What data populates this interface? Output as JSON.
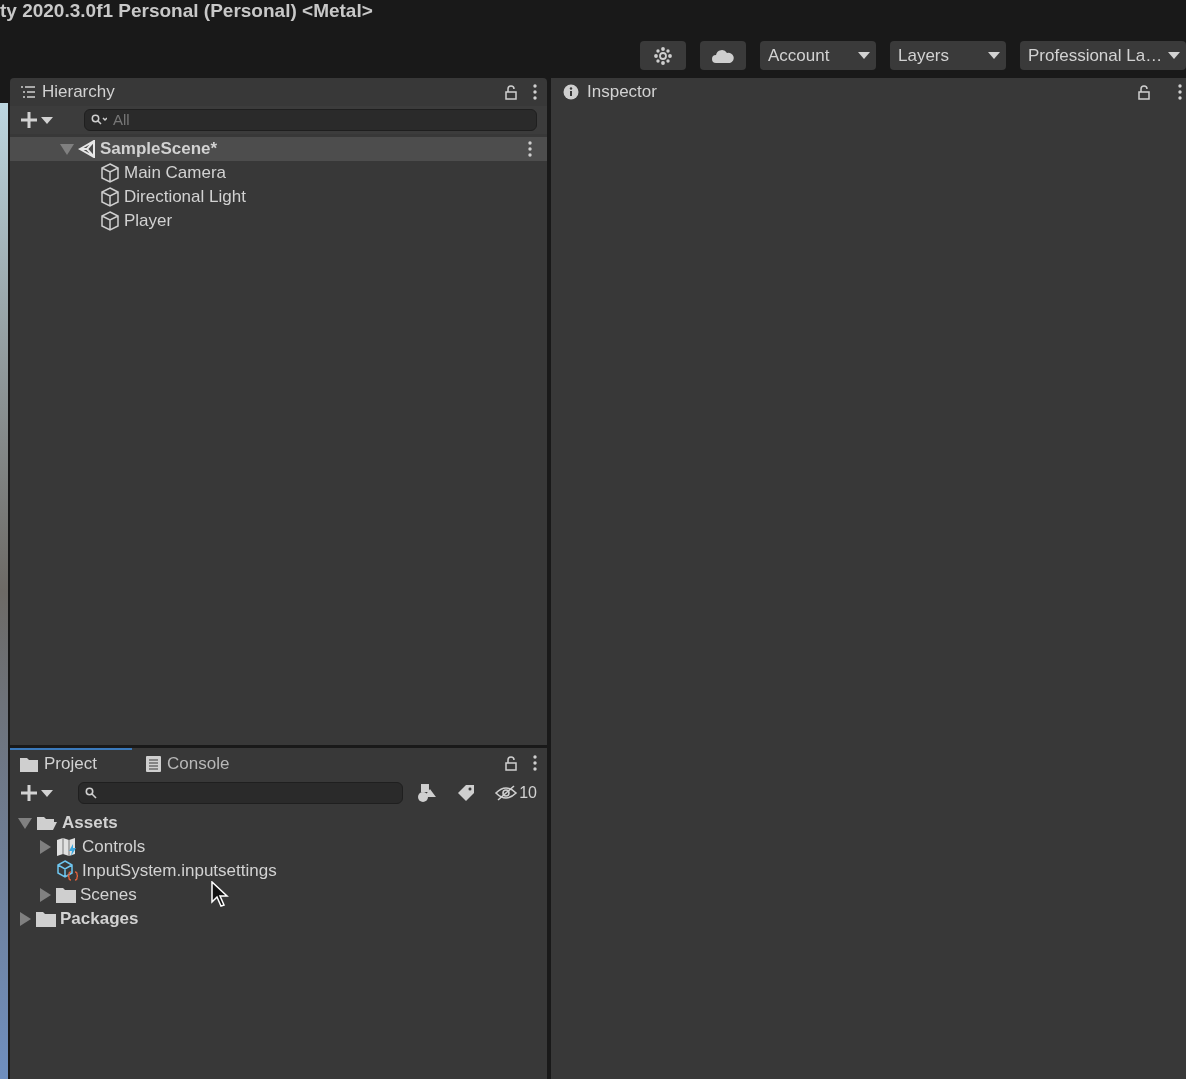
{
  "window": {
    "title": "ty 2020.3.0f1 Personal (Personal) <Metal>"
  },
  "toolbar": {
    "dropdowns": [
      "Account",
      "Layers",
      "Professional La…"
    ]
  },
  "hierarchy": {
    "title": "Hierarchy",
    "search": {
      "placeholder": "All"
    },
    "tree": [
      {
        "label": "SampleScene*",
        "kind": "scene",
        "expanded": true,
        "children": [
          {
            "label": "Main Camera",
            "kind": "object"
          },
          {
            "label": "Directional Light",
            "kind": "object"
          },
          {
            "label": "Player",
            "kind": "object"
          }
        ]
      }
    ]
  },
  "inspector": {
    "title": "Inspector"
  },
  "project": {
    "tabs": [
      {
        "label": "Project",
        "kind": "project",
        "selected": true
      },
      {
        "label": "Console",
        "kind": "console",
        "selected": false
      }
    ],
    "hidden_count": "10",
    "tree": [
      {
        "label": "Assets",
        "kind": "folder",
        "bold": true,
        "expanded": true,
        "children": [
          {
            "label": "Controls",
            "kind": "actions",
            "expanded": false
          },
          {
            "label": "InputSystem.inputsettings",
            "kind": "settings"
          },
          {
            "label": "Scenes",
            "kind": "folder",
            "expanded": false
          }
        ]
      },
      {
        "label": "Packages",
        "kind": "folder",
        "bold": true,
        "expanded": false
      }
    ]
  }
}
